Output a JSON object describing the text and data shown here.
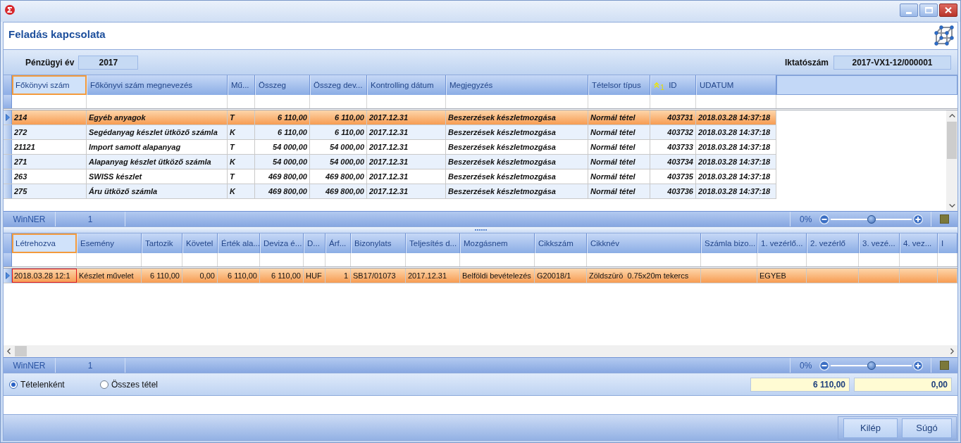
{
  "window": {
    "title": "Feladás kapcsolata"
  },
  "parameters": {
    "fiscal_year": {
      "label": "Pénzügyi év",
      "value": "2017"
    },
    "registration_number": {
      "label": "Iktatószám",
      "value": "2017-VX1-12/000001"
    }
  },
  "upper_grid": {
    "focused": false,
    "columns": [
      {
        "label": "Főkönyvi szám",
        "kind": "text",
        "selected": true
      },
      {
        "label": "Főkönyvi szám megnevezés",
        "kind": "text",
        "selected": false
      },
      {
        "label": "Mű...",
        "kind": "text",
        "selected": false
      },
      {
        "label": "Összeg",
        "kind": "number",
        "selected": false
      },
      {
        "label": "Összeg dev...",
        "kind": "number",
        "selected": false
      },
      {
        "label": "Kontrolling dátum",
        "kind": "text",
        "selected": false
      },
      {
        "label": "Megjegyzés",
        "kind": "text",
        "selected": false
      },
      {
        "label": "Tételsor típus",
        "kind": "text",
        "selected": false
      },
      {
        "label": "ID",
        "kind": "number",
        "selected": false,
        "sort": {
          "ascending": true,
          "order": "1"
        }
      },
      {
        "label": "UDATUM",
        "kind": "text",
        "selected": false
      }
    ],
    "rows": [
      {
        "selected": true,
        "cells": [
          "214",
          "Egyéb anyagok",
          "T",
          "6 110,00",
          "6 110,00",
          "2017.12.31",
          "Beszerzések készletmozgása",
          "Normál tétel",
          "403731",
          "2018.03.28 14:37:18"
        ]
      },
      {
        "selected": false,
        "cells": [
          "272",
          "Segédanyag készlet ütköző számla",
          "K",
          "6 110,00",
          "6 110,00",
          "2017.12.31",
          "Beszerzések készletmozgása",
          "Normál tétel",
          "403732",
          "2018.03.28 14:37:18"
        ]
      },
      {
        "selected": false,
        "cells": [
          "21121",
          "Import samott alapanyag",
          "T",
          "54 000,00",
          "54 000,00",
          "2017.12.31",
          "Beszerzések készletmozgása",
          "Normál tétel",
          "403733",
          "2018.03.28 14:37:18"
        ]
      },
      {
        "selected": false,
        "cells": [
          "271",
          "Alapanyag készlet ütköző számla",
          "K",
          "54 000,00",
          "54 000,00",
          "2017.12.31",
          "Beszerzések készletmozgása",
          "Normál tétel",
          "403734",
          "2018.03.28 14:37:18"
        ]
      },
      {
        "selected": false,
        "cells": [
          "263",
          "SWISS készlet",
          "T",
          "469 800,00",
          "469 800,00",
          "2017.12.31",
          "Beszerzések készletmozgása",
          "Normál tétel",
          "403735",
          "2018.03.28 14:37:18"
        ]
      },
      {
        "selected": false,
        "cells": [
          "275",
          "Áru ütköző számla",
          "K",
          "469 800,00",
          "469 800,00",
          "2017.12.31",
          "Beszerzések készletmozgása",
          "Normál tétel",
          "403736",
          "2018.03.28 14:37:18"
        ]
      }
    ],
    "status_bar": {
      "source": "WinNER",
      "count": "1",
      "zoom": "0%",
      "zoom_slider": {
        "level": 0.5
      }
    }
  },
  "lower_grid": {
    "focused": true,
    "columns": [
      {
        "label": "Létrehozva",
        "kind": "text",
        "selected": true
      },
      {
        "label": "Esemény",
        "kind": "text",
        "selected": false
      },
      {
        "label": "Tartozik",
        "kind": "number",
        "selected": false
      },
      {
        "label": "Követel",
        "kind": "number",
        "selected": false
      },
      {
        "label": "Érték ala...",
        "kind": "number",
        "selected": false
      },
      {
        "label": "Deviza é...",
        "kind": "number",
        "selected": false
      },
      {
        "label": "D...",
        "kind": "text",
        "selected": false
      },
      {
        "label": "Árf...",
        "kind": "number",
        "selected": false
      },
      {
        "label": "Bizonylats",
        "kind": "text",
        "selected": false
      },
      {
        "label": "Teljesítés d...",
        "kind": "text",
        "selected": false
      },
      {
        "label": "Mozgásnem",
        "kind": "text",
        "selected": false
      },
      {
        "label": "Cikkszám",
        "kind": "text",
        "selected": false
      },
      {
        "label": "Cikknév",
        "kind": "text",
        "selected": false
      },
      {
        "label": "Számla bizo...",
        "kind": "text",
        "selected": false
      },
      {
        "label": "1. vezérlő...",
        "kind": "text",
        "selected": false
      },
      {
        "label": "2. vezérlő",
        "kind": "text",
        "selected": false
      },
      {
        "label": "3. vezé...",
        "kind": "text",
        "selected": false
      },
      {
        "label": "4. vez...",
        "kind": "text",
        "selected": false
      },
      {
        "label": "I",
        "kind": "text",
        "selected": false
      }
    ],
    "rows": [
      {
        "selected": true,
        "cells": [
          "2018.03.28 12:1",
          "Készlet művelet",
          "6 110,00",
          "0,00",
          "6 110,00",
          "6 110,00",
          "HUF",
          "1",
          "SB17/01073",
          "2017.12.31",
          "Belföldi bevételezés",
          "G20018/1",
          "Zöldszürö  0.75x20m tekercs",
          null,
          "EGYEB",
          null,
          null,
          null,
          null
        ]
      }
    ],
    "status_bar": {
      "source": "WinNER",
      "count": "1",
      "zoom": "0%",
      "zoom_slider": {
        "level": 0.5
      }
    }
  },
  "view_mode": [
    {
      "label": "Tételenként",
      "selected": true
    },
    {
      "label": "Összes tétel",
      "selected": false
    }
  ],
  "totals": [
    "6 110,00",
    "0,00"
  ],
  "buttons": [
    "Kilép",
    "Súgó"
  ]
}
